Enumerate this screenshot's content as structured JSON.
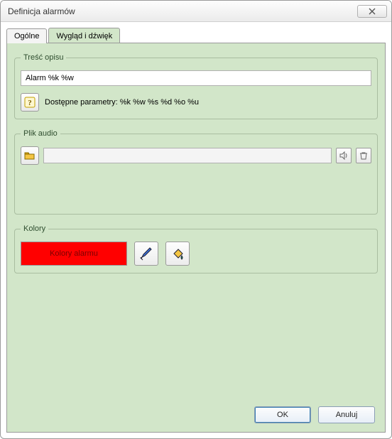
{
  "window": {
    "title": "Definicja alarmów"
  },
  "tabs": {
    "general": "Ogólne",
    "appearance": "Wygląd i dźwięk"
  },
  "groups": {
    "description": {
      "legend": "Treść opisu",
      "value": "Alarm %k %w",
      "params_label": "Dostępne parametry: %k  %w  %s  %d  %o  %u"
    },
    "audio": {
      "legend": "Plik audio",
      "path": ""
    },
    "colors": {
      "legend": "Kolory",
      "swatch_label": "Kolory alarmu",
      "swatch_color": "#ff0000"
    }
  },
  "buttons": {
    "ok": "OK",
    "cancel": "Anuluj"
  }
}
